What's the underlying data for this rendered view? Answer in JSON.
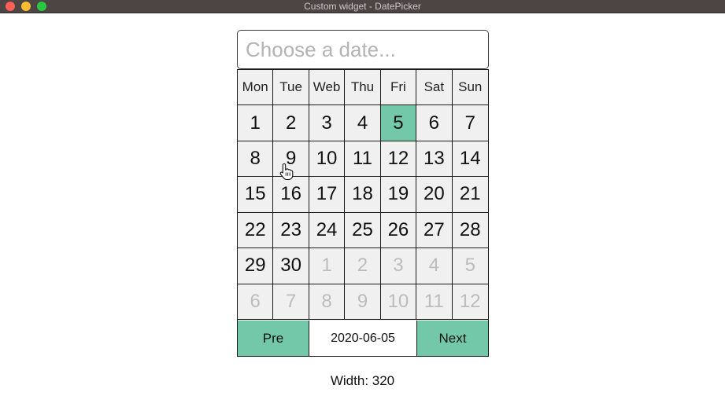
{
  "window": {
    "title": "Custom widget - DatePicker"
  },
  "date_input": {
    "placeholder": "Choose a date...",
    "value": ""
  },
  "calendar": {
    "weekdays": [
      "Mon",
      "Tue",
      "Web",
      "Thu",
      "Fri",
      "Sat",
      "Sun"
    ],
    "days": [
      {
        "label": "1",
        "state": "current"
      },
      {
        "label": "2",
        "state": "current"
      },
      {
        "label": "3",
        "state": "current"
      },
      {
        "label": "4",
        "state": "current"
      },
      {
        "label": "5",
        "state": "selected"
      },
      {
        "label": "6",
        "state": "current"
      },
      {
        "label": "7",
        "state": "current"
      },
      {
        "label": "8",
        "state": "current"
      },
      {
        "label": "9",
        "state": "current"
      },
      {
        "label": "10",
        "state": "current"
      },
      {
        "label": "11",
        "state": "current"
      },
      {
        "label": "12",
        "state": "current"
      },
      {
        "label": "13",
        "state": "current"
      },
      {
        "label": "14",
        "state": "current"
      },
      {
        "label": "15",
        "state": "current"
      },
      {
        "label": "16",
        "state": "current"
      },
      {
        "label": "17",
        "state": "current"
      },
      {
        "label": "18",
        "state": "current"
      },
      {
        "label": "19",
        "state": "current"
      },
      {
        "label": "20",
        "state": "current"
      },
      {
        "label": "21",
        "state": "current"
      },
      {
        "label": "22",
        "state": "current"
      },
      {
        "label": "23",
        "state": "current"
      },
      {
        "label": "24",
        "state": "current"
      },
      {
        "label": "25",
        "state": "current"
      },
      {
        "label": "26",
        "state": "current"
      },
      {
        "label": "27",
        "state": "current"
      },
      {
        "label": "28",
        "state": "current"
      },
      {
        "label": "29",
        "state": "current"
      },
      {
        "label": "30",
        "state": "current"
      },
      {
        "label": "1",
        "state": "other"
      },
      {
        "label": "2",
        "state": "other"
      },
      {
        "label": "3",
        "state": "other"
      },
      {
        "label": "4",
        "state": "other"
      },
      {
        "label": "5",
        "state": "other"
      },
      {
        "label": "6",
        "state": "other"
      },
      {
        "label": "7",
        "state": "other"
      },
      {
        "label": "8",
        "state": "other"
      },
      {
        "label": "9",
        "state": "other"
      },
      {
        "label": "10",
        "state": "other"
      },
      {
        "label": "11",
        "state": "other"
      },
      {
        "label": "12",
        "state": "other"
      }
    ],
    "prev_label": "Pre",
    "next_label": "Next",
    "current_date": "2020-06-05"
  },
  "width_label": "Width: 320",
  "colors": {
    "accent": "#74c8aa",
    "cell_bg": "#f0f0f0",
    "border": "#1a1a1a",
    "muted_text": "#bcbcbc",
    "titlebar": "#4d4444"
  },
  "icons": [
    "close-button-icon",
    "minimize-button-icon",
    "maximize-button-icon",
    "hand-pointer-cursor-icon"
  ]
}
